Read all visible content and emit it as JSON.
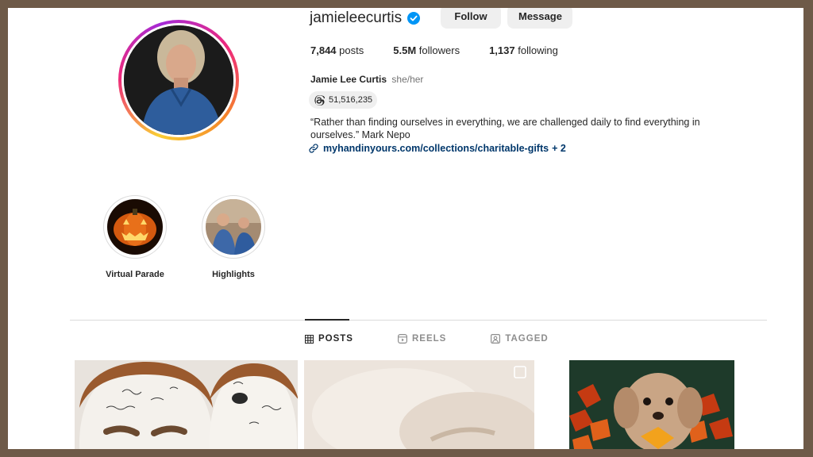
{
  "profile": {
    "username": "jamieleecurtis",
    "follow_label": "Follow",
    "message_label": "Message",
    "stats": {
      "posts_count": "7,844",
      "posts_label": "posts",
      "followers_count": "5.5M",
      "followers_label": "followers",
      "following_count": "1,137",
      "following_label": "following"
    },
    "full_name": "Jamie Lee Curtis",
    "pronouns": "she/her",
    "threads_count": "51,516,235",
    "bio": "“Rather than finding ourselves in everything, we are challenged daily to find everything in ourselves.” Mark Nepo",
    "link_text": "myhandinyours.com/collections/charitable-gifts",
    "link_more": "+ 2"
  },
  "highlights": [
    {
      "label": "Virtual Parade"
    },
    {
      "label": "Highlights"
    }
  ],
  "tabs": [
    {
      "label": "POSTS",
      "active": true
    },
    {
      "label": "REELS",
      "active": false
    },
    {
      "label": "TAGGED",
      "active": false
    }
  ],
  "colors": {
    "frame": "#6e5a48",
    "verified": "#0095f6",
    "link": "#00376b",
    "button_bg": "#efefef"
  }
}
